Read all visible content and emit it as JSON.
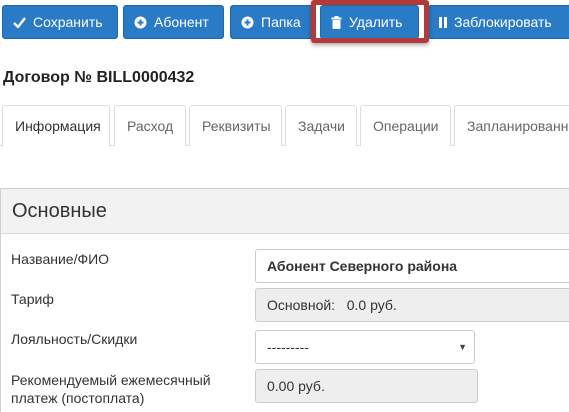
{
  "toolbar": {
    "save_label": "Сохранить",
    "abonent_label": "Абонент",
    "folder_label": "Папка",
    "delete_label": "Удалить",
    "block_label": "Заблокировать"
  },
  "page": {
    "title": "Договор № BILL0000432"
  },
  "tabs": [
    {
      "label": "Информация"
    },
    {
      "label": "Расход"
    },
    {
      "label": "Реквизиты"
    },
    {
      "label": "Задачи"
    },
    {
      "label": "Операции"
    },
    {
      "label": "Запланированные"
    }
  ],
  "section": {
    "title": "Основные"
  },
  "fields": {
    "name": {
      "label": "Название/ФИО",
      "value": "Абонент Северного района"
    },
    "tariff": {
      "label": "Тариф",
      "value": "Основной:   0.0 руб."
    },
    "loyalty": {
      "label": "Лояльность/Скидки",
      "value": "---------"
    },
    "payment": {
      "label_line1": "Рекомендуемый ежемесячный",
      "label_line2": "платеж (постоплата)",
      "value": "0.00 руб."
    }
  },
  "colors": {
    "button": "#2a7bc6",
    "highlight": "#b43a3a"
  }
}
